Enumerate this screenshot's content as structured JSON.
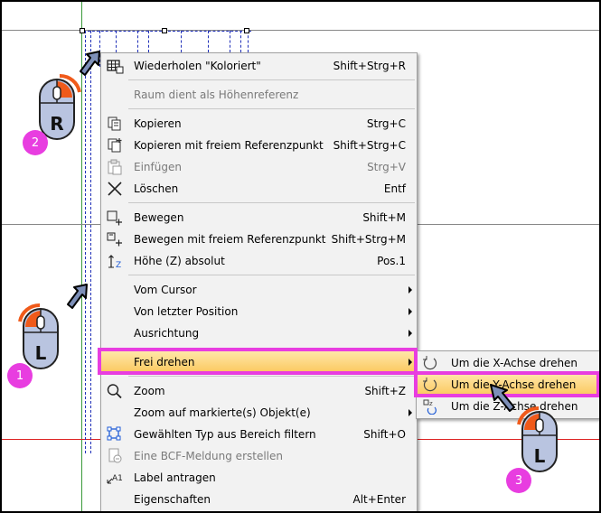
{
  "context_menu": {
    "items": [
      {
        "label": "Wiederholen \"Koloriert\"",
        "shortcut": "Shift+Strg+R",
        "icon": "repeat-grid-icon"
      },
      {
        "label": "Raum dient als Höhenreferenz",
        "shortcut": "",
        "icon": ""
      },
      {
        "label": "Kopieren",
        "shortcut": "Strg+C",
        "icon": "copy-icon"
      },
      {
        "label": "Kopieren mit freiem Referenzpunkt",
        "shortcut": "Shift+Strg+C",
        "icon": "copy-reference-icon"
      },
      {
        "label": "Einfügen",
        "shortcut": "Strg+V",
        "icon": "paste-icon"
      },
      {
        "label": "Löschen",
        "shortcut": "Entf",
        "icon": "delete-x-icon"
      },
      {
        "label": "Bewegen",
        "shortcut": "Shift+M",
        "icon": "move-icon"
      },
      {
        "label": "Bewegen mit freiem Referenzpunkt",
        "shortcut": "Shift+Strg+M",
        "icon": "move-reference-icon"
      },
      {
        "label": "Höhe (Z) absolut",
        "shortcut": "Pos.1",
        "icon": "height-z-icon"
      },
      {
        "label": "Vom Cursor",
        "shortcut": "",
        "icon": ""
      },
      {
        "label": "Von letzter Position",
        "shortcut": "",
        "icon": ""
      },
      {
        "label": "Ausrichtung",
        "shortcut": "",
        "icon": ""
      },
      {
        "label": "Frei drehen",
        "shortcut": "",
        "icon": ""
      },
      {
        "label": "Zoom",
        "shortcut": "Shift+Z",
        "icon": "zoom-magnifier-icon"
      },
      {
        "label": "Zoom auf markierte(s) Objekt(e)",
        "shortcut": "",
        "icon": ""
      },
      {
        "label": "Gewählten Typ aus Bereich filtern",
        "shortcut": "Shift+O",
        "icon": "filter-type-icon"
      },
      {
        "label": "Eine BCF-Meldung erstellen",
        "shortcut": "",
        "icon": "bcf-icon"
      },
      {
        "label": "Label antragen",
        "shortcut": "",
        "icon": "label-a1-icon"
      },
      {
        "label": "Eigenschaften",
        "shortcut": "Alt+Enter",
        "icon": ""
      }
    ]
  },
  "submenu": {
    "items": [
      {
        "label": "Um die X-Achse drehen",
        "icon": "rotate-x-icon"
      },
      {
        "label": "Um die Y-Achse drehen",
        "icon": "rotate-y-icon"
      },
      {
        "label": "Um die Z-Achse drehen",
        "icon": "rotate-z-icon"
      }
    ]
  },
  "mice": [
    {
      "letter": "R",
      "badge": "2"
    },
    {
      "letter": "L",
      "badge": "1"
    },
    {
      "letter": "L",
      "badge": "3"
    }
  ],
  "colors": {
    "highlight": "#fbc85e",
    "callout": "#e83de0",
    "mouse_button": "#f05a1a",
    "dash": "#1f2fb8"
  }
}
